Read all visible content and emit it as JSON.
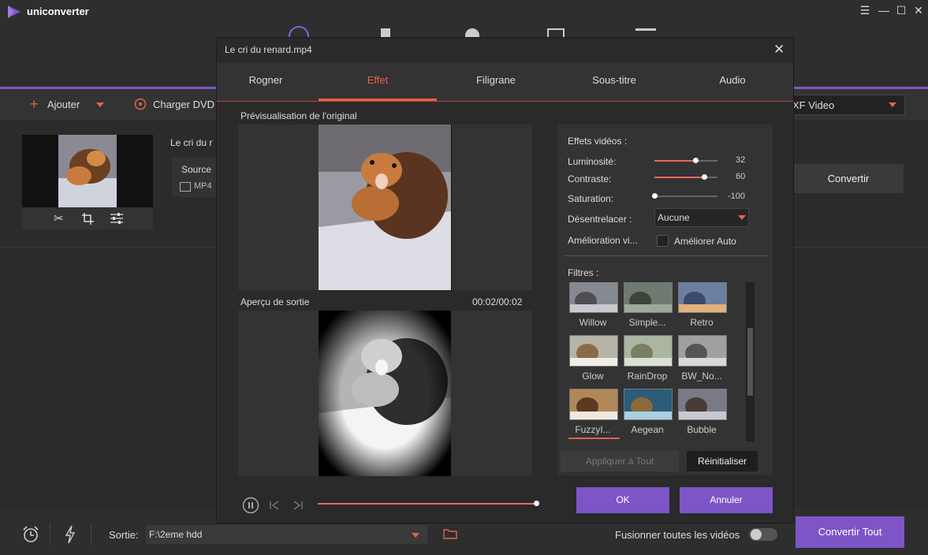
{
  "app": {
    "name": "uniconverter"
  },
  "window_controls": {
    "menu": "☰",
    "minimize": "—",
    "maximize": "☐",
    "close": "✕"
  },
  "toolbar": {
    "add_label": "Ajouter",
    "dvd_label": "Charger DVD",
    "format_value": "XF Video"
  },
  "file": {
    "name_partial": "Le cri du r",
    "source_label": "Source",
    "format": "MP4",
    "convert_label": "Convertir"
  },
  "dialog": {
    "title": "Le cri du renard.mp4",
    "close": "✕",
    "tabs": [
      "Rogner",
      "Effet",
      "Filigrane",
      "Sous-titre",
      "Audio"
    ],
    "active_tab": "Effet",
    "preview_original_label": "Prévisualisation de l'original",
    "preview_output_label": "Aperçu de sortie",
    "time": "00:02/00:02",
    "effects_title": "Effets vidéos :",
    "brightness": {
      "label": "Luminosité:",
      "value": "32"
    },
    "contrast": {
      "label": "Contraste:",
      "value": "60"
    },
    "saturation": {
      "label": "Saturation:",
      "value": "-100"
    },
    "deinterlace": {
      "label": "Désentrelacer :",
      "value": "Aucune"
    },
    "enhance": {
      "label": "Amélioration vi...",
      "checkbox_label": "Améliorer Auto"
    },
    "filters_title": "Filtres :",
    "filters": [
      "Willow",
      "Simple...",
      "Retro",
      "Glow",
      "RainDrop",
      "BW_No...",
      "FuzzyI...",
      "Aegean",
      "Bubble"
    ],
    "selected_filter": "FuzzyI...",
    "apply_all_label": "Appliquer à Tout",
    "reset_label": "Réinitialiser",
    "ok_label": "OK",
    "cancel_label": "Annuler"
  },
  "bottom": {
    "output_label": "Sortie:",
    "output_path": "F:\\2eme hdd",
    "merge_label": "Fusionner toutes les vidéos",
    "convert_all_label": "Convertir Tout"
  },
  "colors": {
    "accent": "#7d55c7",
    "active_tab": "#e8604c",
    "slider": "#e66a5a"
  }
}
